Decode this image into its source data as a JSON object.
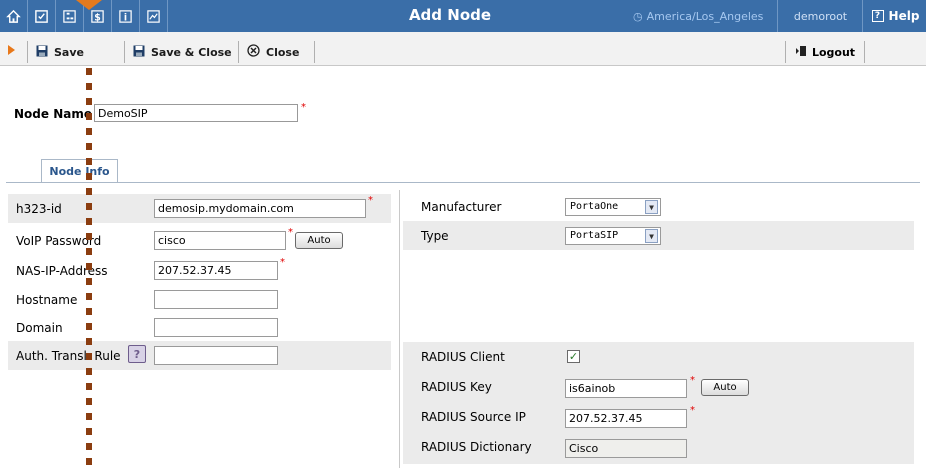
{
  "app": {
    "title": "Add Node",
    "timezone": "America/Los_Angeles",
    "user": "demoroot",
    "help_label": "Help"
  },
  "topicons": [
    {
      "name": "home-icon"
    },
    {
      "name": "checklist-icon"
    },
    {
      "name": "org-chart-icon"
    },
    {
      "name": "dollar-icon"
    },
    {
      "name": "info-icon"
    },
    {
      "name": "stats-chart-icon"
    }
  ],
  "toolbar": {
    "save_label": "Save",
    "save_close_label": "Save & Close",
    "close_label": "Close",
    "logout_label": "Logout"
  },
  "node": {
    "name_label": "Node Name",
    "name_value": "DemoSIP"
  },
  "tabs": [
    {
      "label": "Node Info"
    }
  ],
  "left_form": {
    "h323_id": {
      "label": "h323-id",
      "value": "demosip.mydomain.com"
    },
    "voip_password": {
      "label": "VoIP Password",
      "value": "cisco",
      "button": "Auto"
    },
    "nas_ip": {
      "label": "NAS-IP-Address",
      "value": "207.52.37.45"
    },
    "hostname": {
      "label": "Hostname",
      "value": ""
    },
    "domain": {
      "label": "Domain",
      "value": ""
    },
    "auth_rule": {
      "label": "Auth. Transl. Rule",
      "value": ""
    }
  },
  "right_form": {
    "manufacturer": {
      "label": "Manufacturer",
      "value": "PortaOne"
    },
    "type": {
      "label": "Type",
      "value": "PortaSIP"
    },
    "radius_client": {
      "label": "RADIUS Client",
      "checked": true
    },
    "radius_key": {
      "label": "RADIUS Key",
      "value": "is6ainob",
      "button": "Auto"
    },
    "radius_source_ip": {
      "label": "RADIUS Source IP",
      "value": "207.52.37.45"
    },
    "radius_dictionary": {
      "label": "RADIUS Dictionary",
      "value": "Cisco"
    }
  },
  "colors": {
    "topbar": "#3a6ea8",
    "required": "#e00000",
    "guide": "#8b3d10"
  }
}
